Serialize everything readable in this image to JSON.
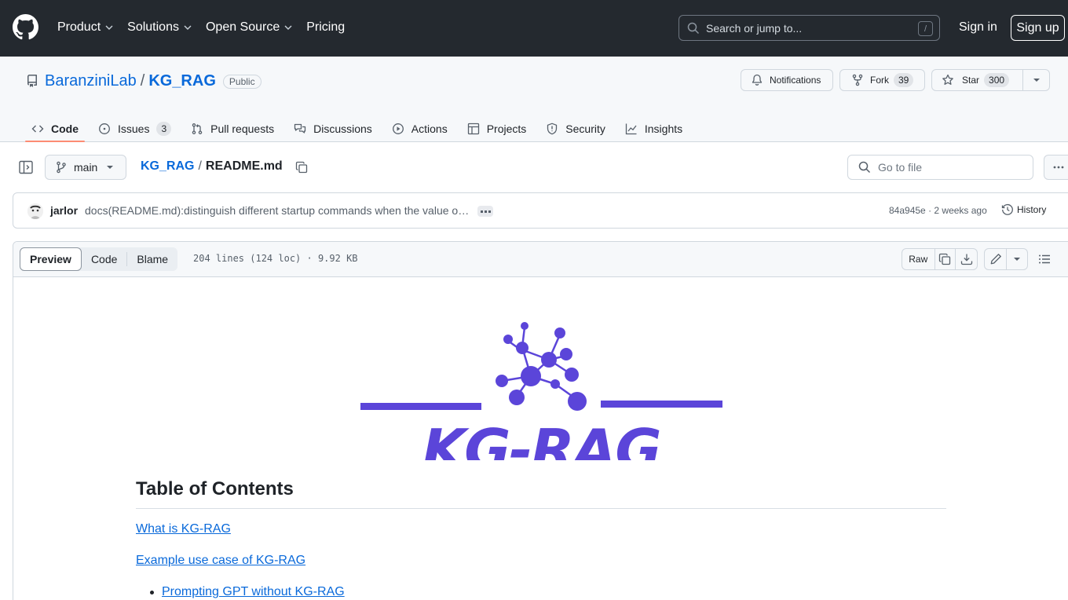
{
  "header": {
    "nav": [
      {
        "label": "Product",
        "has_dropdown": true
      },
      {
        "label": "Solutions",
        "has_dropdown": true
      },
      {
        "label": "Open Source",
        "has_dropdown": true
      },
      {
        "label": "Pricing",
        "has_dropdown": false
      }
    ],
    "search_placeholder": "Search or jump to...",
    "search_shortcut": "/",
    "sign_in": "Sign in",
    "sign_up": "Sign up"
  },
  "repo": {
    "owner": "BaranziniLab",
    "separator": "/",
    "name": "KG_RAG",
    "visibility": "Public",
    "notifications_label": "Notifications",
    "fork_label": "Fork",
    "fork_count": "39",
    "star_label": "Star",
    "star_count": "300"
  },
  "tabs": [
    {
      "label": "Code",
      "icon": "code-icon",
      "active": true
    },
    {
      "label": "Issues",
      "icon": "issue-icon",
      "count": "3"
    },
    {
      "label": "Pull requests",
      "icon": "pull-request-icon"
    },
    {
      "label": "Discussions",
      "icon": "discussions-icon"
    },
    {
      "label": "Actions",
      "icon": "play-icon"
    },
    {
      "label": "Projects",
      "icon": "table-icon"
    },
    {
      "label": "Security",
      "icon": "shield-icon"
    },
    {
      "label": "Insights",
      "icon": "graph-icon"
    }
  ],
  "file_nav": {
    "branch": "main",
    "path_repo": "KG_RAG",
    "path_sep": "/",
    "path_file": "README.md",
    "goto_placeholder": "Go to file"
  },
  "commit": {
    "author": "jarlor",
    "message": "docs(README.md):distinguish different startup commands when the value of the setting is different",
    "sha": "84a945e",
    "dot": "·",
    "time": "2 weeks ago",
    "history_label": "History"
  },
  "file": {
    "view_tabs": [
      "Preview",
      "Code",
      "Blame"
    ],
    "info": "204 lines (124 loc) · 9.92 KB",
    "raw_label": "Raw"
  },
  "readme": {
    "logo_text": "KG-RAG",
    "toc_title": "Table of Contents",
    "links": [
      "What is KG-RAG",
      "Example use case of KG-RAG",
      "Prompting GPT without KG-RAG"
    ]
  },
  "colors": {
    "header_bg": "#24292f",
    "link": "#0969da",
    "active_tab_underline": "#fd8c73",
    "logo_purple": "#5b45d9"
  }
}
